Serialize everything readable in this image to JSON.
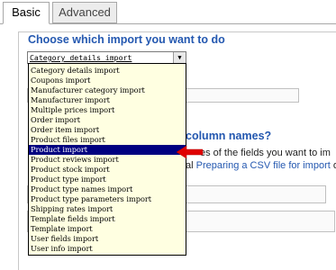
{
  "tabs": [
    {
      "label": "Basic",
      "active": true
    },
    {
      "label": "Advanced",
      "active": false
    }
  ],
  "section1": {
    "heading": "Choose which import you want to do",
    "select": {
      "value": "Category details import",
      "arrow_icon": "chevron-down-icon",
      "options": [
        "Category details import",
        "Coupons import",
        "Manufacturer category import",
        "Manufacturer import",
        "Multiple prices import",
        "Order import",
        "Order item import",
        "Product files import",
        "Product import",
        "Product reviews import",
        "Product stock import",
        "Product type import",
        "Product type names import",
        "Product type parameters import",
        "Shipping rates import",
        "Template fields import",
        "Template import",
        "User fields import",
        "User info import"
      ],
      "highlighted_option": "Product import"
    }
  },
  "section2": {
    "heading_visible": "column names?",
    "line1_visible": "es of the fields you want to im",
    "line2_prefix": "al ",
    "line2_link": "Preparing a CSV file for import",
    "line2_suffix": " or"
  },
  "colors": {
    "heading": "#2458b0",
    "link": "#2458b0",
    "dropdown_bg": "#ffffe1",
    "selected_bg": "#000080",
    "pointer": "#e00000"
  }
}
